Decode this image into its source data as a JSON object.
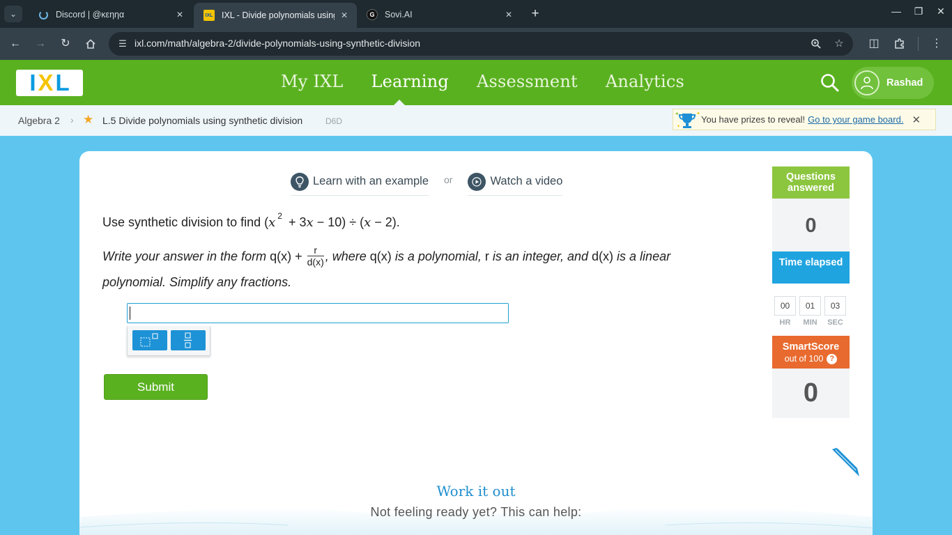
{
  "browser": {
    "tabs": [
      {
        "title": "Discord | @κεηηα",
        "icon": "loading-spinner-icon"
      },
      {
        "title": "IXL - Divide polynomials using synthetic division",
        "icon": "ixl-favicon",
        "favicon_text": "IXL"
      },
      {
        "title": "Sovi.AI",
        "icon": "sovi-favicon",
        "favicon_text": "G"
      }
    ],
    "url": "ixl.com/math/algebra-2/divide-polynomials-using-synthetic-division"
  },
  "header": {
    "logo": [
      "I",
      "X",
      "L"
    ],
    "nav": [
      "My IXL",
      "Learning",
      "Assessment",
      "Analytics"
    ],
    "active_nav": "Learning",
    "user_name": "Rashad"
  },
  "breadcrumb": {
    "course": "Algebra 2",
    "skill": "L.5 Divide polynomials using synthetic division",
    "code": "D6D"
  },
  "prize": {
    "text": "You have prizes to reveal!",
    "link": "Go to your game board."
  },
  "help": {
    "example": "Learn with an example",
    "or": "or",
    "video": "Watch a video"
  },
  "question": {
    "lead": "Use synthetic division to find",
    "x": "x",
    "exp": "2",
    "rest1": "+ 3",
    "x2": "x",
    "rest2": "− 10) ÷ (",
    "x3": "x",
    "rest3": "− 2).",
    "open": "(",
    "line2_a": "Write your answer in the form",
    "qx": "q(x) +",
    "frac_num": "r",
    "frac_den": "d(x)",
    "line2_b": ", where",
    "qx2": "q(x)",
    "line2_c": "is a polynomial,",
    "r": "r",
    "line2_d": "is an integer, and",
    "dx": "d(x)",
    "line2_e": "is a linear polynomial. Simplify any fractions."
  },
  "answer": {
    "value": ""
  },
  "submit_label": "Submit",
  "stats": {
    "questions_label": "Questions answered",
    "questions_value": "0",
    "time_label": "Time elapsed",
    "hr": "00",
    "min": "01",
    "sec": "03",
    "hr_label": "HR",
    "min_label": "MIN",
    "sec_label": "SEC",
    "smartscore_label": "SmartScore",
    "smartscore_sub": "out of 100",
    "smartscore_help": "?",
    "smartscore_value": "0"
  },
  "workout": {
    "title": "Work it out",
    "subtitle": "Not feeling ready yet? This can help:"
  },
  "colors": {
    "ixl_green": "#5ab120",
    "questions_head": "#8cc63f",
    "time_head": "#20a4e0",
    "smartscore_head": "#e86a2e",
    "link_blue": "#1d6aa6"
  }
}
